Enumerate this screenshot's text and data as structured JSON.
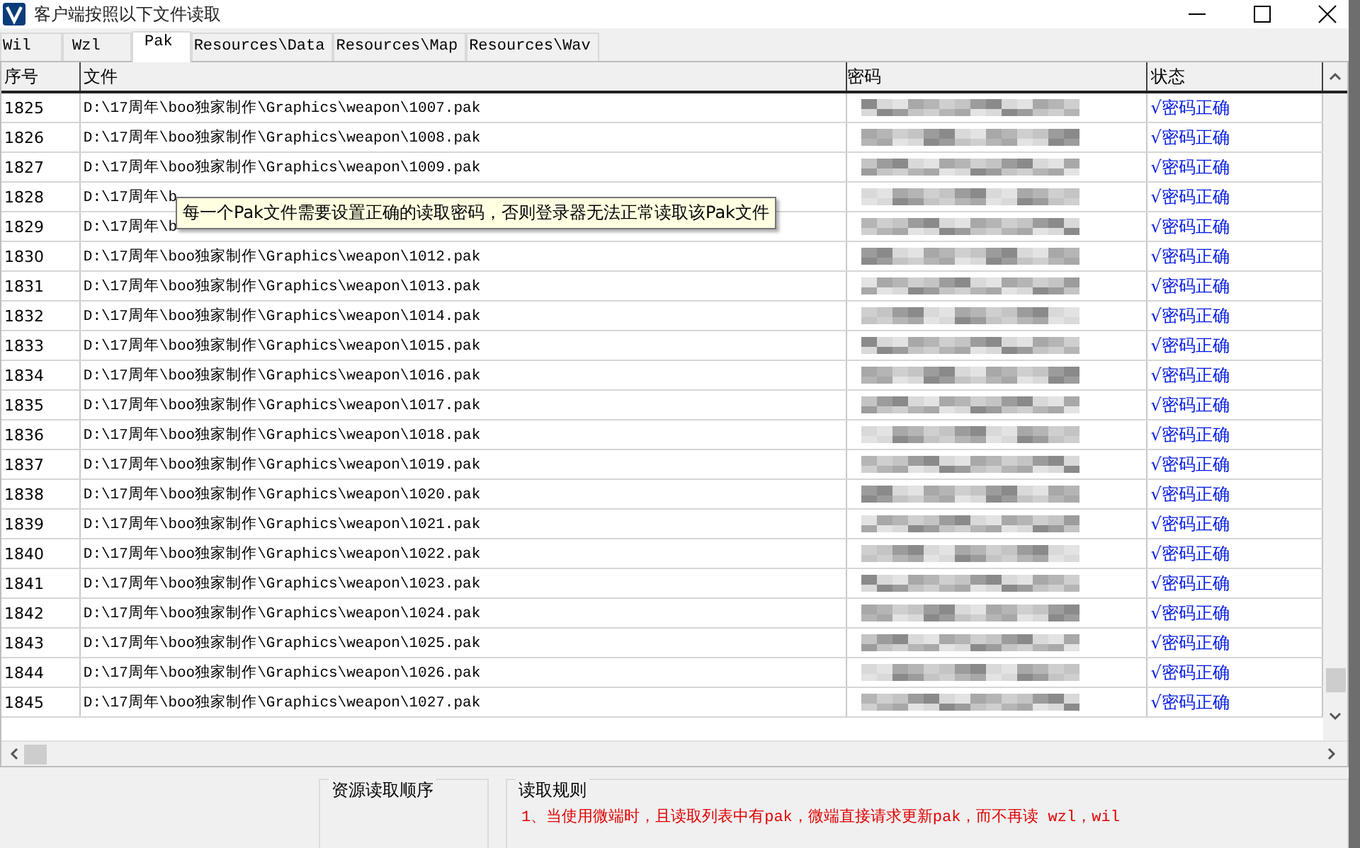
{
  "window": {
    "title": "客户端按照以下文件读取"
  },
  "tabs": [
    {
      "label": "Wil",
      "selected": false
    },
    {
      "label": "Wzl",
      "selected": false
    },
    {
      "label": "Pak",
      "selected": true
    },
    {
      "label": "Resources\\Data",
      "selected": false
    },
    {
      "label": "Resources\\Map",
      "selected": false
    },
    {
      "label": "Resources\\Wav",
      "selected": false
    }
  ],
  "table": {
    "columns": [
      "序号",
      "文件",
      "密码",
      "状态"
    ],
    "rows": [
      {
        "index": "1825",
        "file": "D:\\17周年\\boo独家制作\\Graphics\\weapon\\1007.pak",
        "status": "√密码正确"
      },
      {
        "index": "1826",
        "file": "D:\\17周年\\boo独家制作\\Graphics\\weapon\\1008.pak",
        "status": "√密码正确"
      },
      {
        "index": "1827",
        "file": "D:\\17周年\\boo独家制作\\Graphics\\weapon\\1009.pak",
        "status": "√密码正确"
      },
      {
        "index": "1828",
        "file": "D:\\17周年\\b",
        "status": "√密码正确"
      },
      {
        "index": "1829",
        "file": "D:\\17周年\\b",
        "status": "√密码正确"
      },
      {
        "index": "1830",
        "file": "D:\\17周年\\boo独家制作\\Graphics\\weapon\\1012.pak",
        "status": "√密码正确"
      },
      {
        "index": "1831",
        "file": "D:\\17周年\\boo独家制作\\Graphics\\weapon\\1013.pak",
        "status": "√密码正确"
      },
      {
        "index": "1832",
        "file": "D:\\17周年\\boo独家制作\\Graphics\\weapon\\1014.pak",
        "status": "√密码正确"
      },
      {
        "index": "1833",
        "file": "D:\\17周年\\boo独家制作\\Graphics\\weapon\\1015.pak",
        "status": "√密码正确"
      },
      {
        "index": "1834",
        "file": "D:\\17周年\\boo独家制作\\Graphics\\weapon\\1016.pak",
        "status": "√密码正确"
      },
      {
        "index": "1835",
        "file": "D:\\17周年\\boo独家制作\\Graphics\\weapon\\1017.pak",
        "status": "√密码正确"
      },
      {
        "index": "1836",
        "file": "D:\\17周年\\boo独家制作\\Graphics\\weapon\\1018.pak",
        "status": "√密码正确"
      },
      {
        "index": "1837",
        "file": "D:\\17周年\\boo独家制作\\Graphics\\weapon\\1019.pak",
        "status": "√密码正确"
      },
      {
        "index": "1838",
        "file": "D:\\17周年\\boo独家制作\\Graphics\\weapon\\1020.pak",
        "status": "√密码正确"
      },
      {
        "index": "1839",
        "file": "D:\\17周年\\boo独家制作\\Graphics\\weapon\\1021.pak",
        "status": "√密码正确"
      },
      {
        "index": "1840",
        "file": "D:\\17周年\\boo独家制作\\Graphics\\weapon\\1022.pak",
        "status": "√密码正确"
      },
      {
        "index": "1841",
        "file": "D:\\17周年\\boo独家制作\\Graphics\\weapon\\1023.pak",
        "status": "√密码正确"
      },
      {
        "index": "1842",
        "file": "D:\\17周年\\boo独家制作\\Graphics\\weapon\\1024.pak",
        "status": "√密码正确"
      },
      {
        "index": "1843",
        "file": "D:\\17周年\\boo独家制作\\Graphics\\weapon\\1025.pak",
        "status": "√密码正确"
      },
      {
        "index": "1844",
        "file": "D:\\17周年\\boo独家制作\\Graphics\\weapon\\1026.pak",
        "status": "√密码正确"
      },
      {
        "index": "1845",
        "file": "D:\\17周年\\boo独家制作\\Graphics\\weapon\\1027.pak",
        "status": "√密码正确"
      }
    ]
  },
  "tooltip": "每一个Pak文件需要设置正确的读取密码，否则登录器无法正常读取该Pak文件",
  "bottom": {
    "order_title": "资源读取顺序",
    "rules_title": "读取规则",
    "rules": [
      "1、当使用微端时，且读取列表中有pak，微端直接请求更新pak，而不再读 wzl，wil"
    ]
  }
}
